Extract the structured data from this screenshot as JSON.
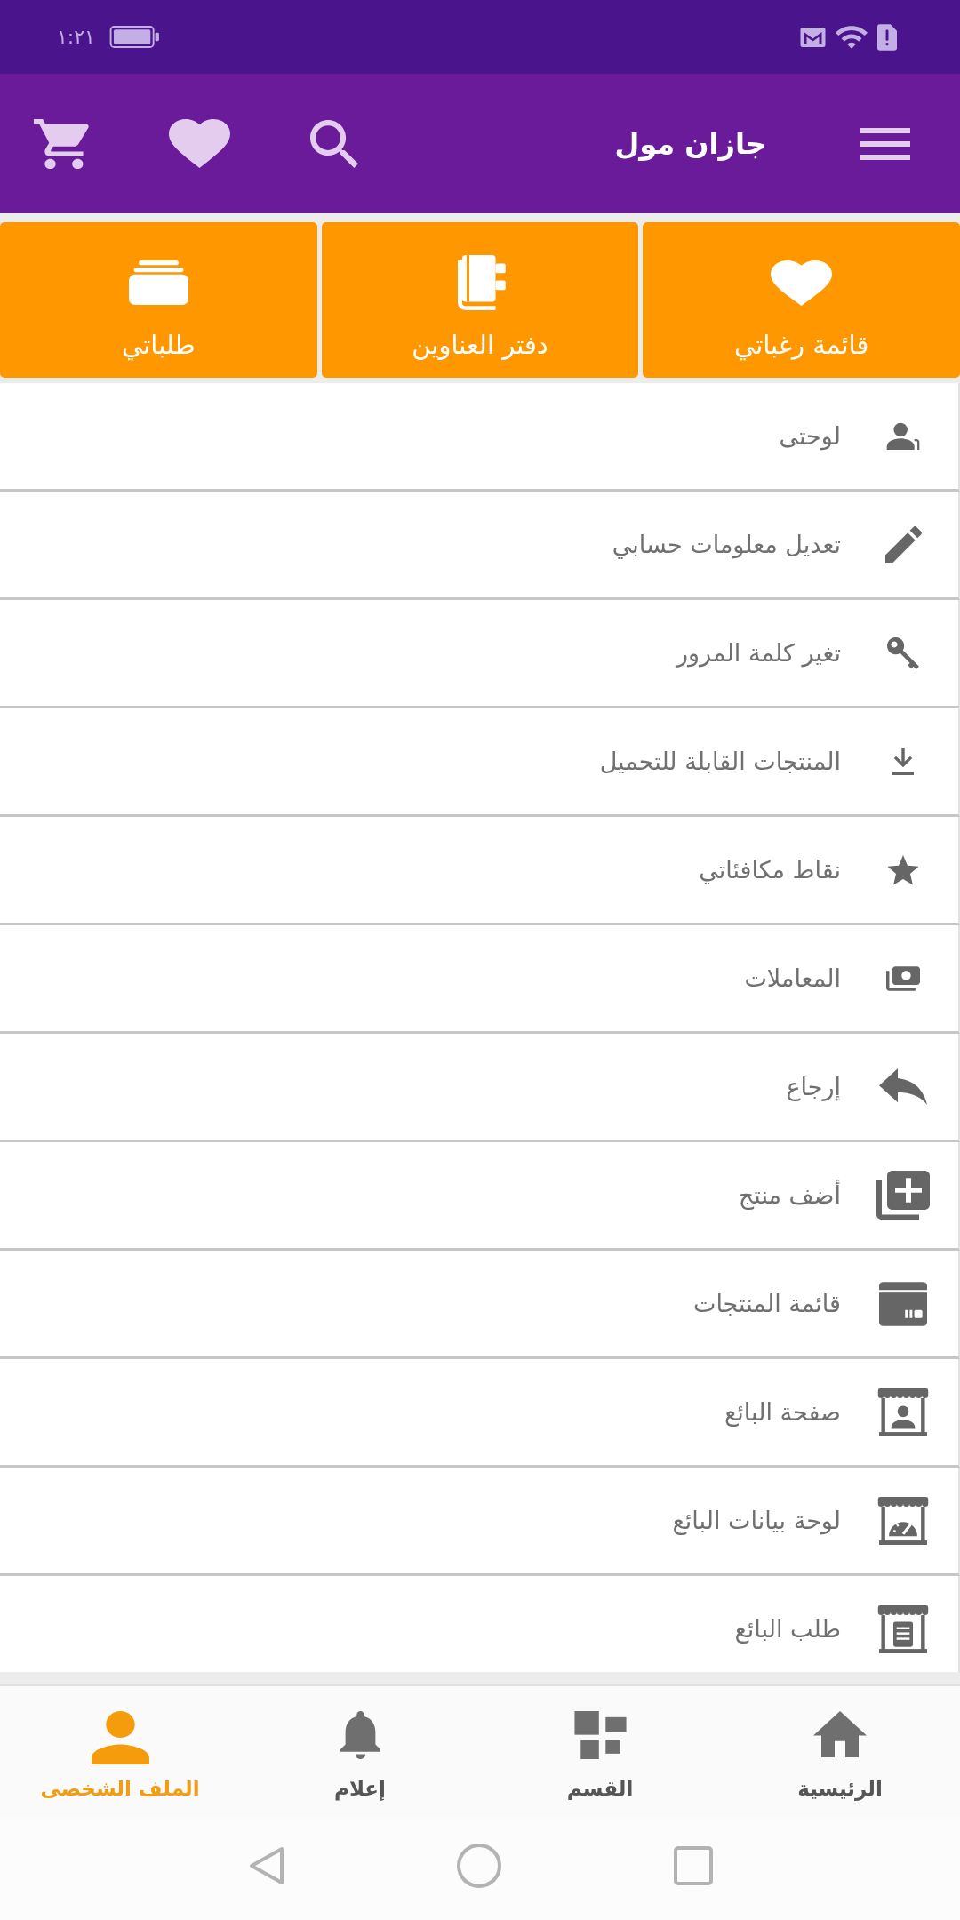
{
  "status_bar": {
    "time": "١:٢١"
  },
  "app_bar": {
    "title": "جازان مول"
  },
  "shortcuts": [
    {
      "label": "قائمة رغباتي"
    },
    {
      "label": "دفتر العناوين"
    },
    {
      "label": "طلباتي"
    }
  ],
  "menu": [
    {
      "label": "لوحتى"
    },
    {
      "label": "تعديل معلومات حسابي"
    },
    {
      "label": "تغير كلمة المرور"
    },
    {
      "label": "المنتجات القابلة للتحميل"
    },
    {
      "label": "نقاط مكافئاتي"
    },
    {
      "label": "المعاملات"
    },
    {
      "label": "إرجاع"
    },
    {
      "label": "أضف منتج"
    },
    {
      "label": "قائمة المنتجات"
    },
    {
      "label": "صفحة البائع"
    },
    {
      "label": "لوحة بيانات البائع"
    },
    {
      "label": "طلب البائع"
    }
  ],
  "bottom_nav": [
    {
      "label": "الرئيسية",
      "selected": false
    },
    {
      "label": "القسم",
      "selected": false
    },
    {
      "label": "إعلام",
      "selected": false
    },
    {
      "label": "الملف الشخصى",
      "selected": true
    }
  ]
}
